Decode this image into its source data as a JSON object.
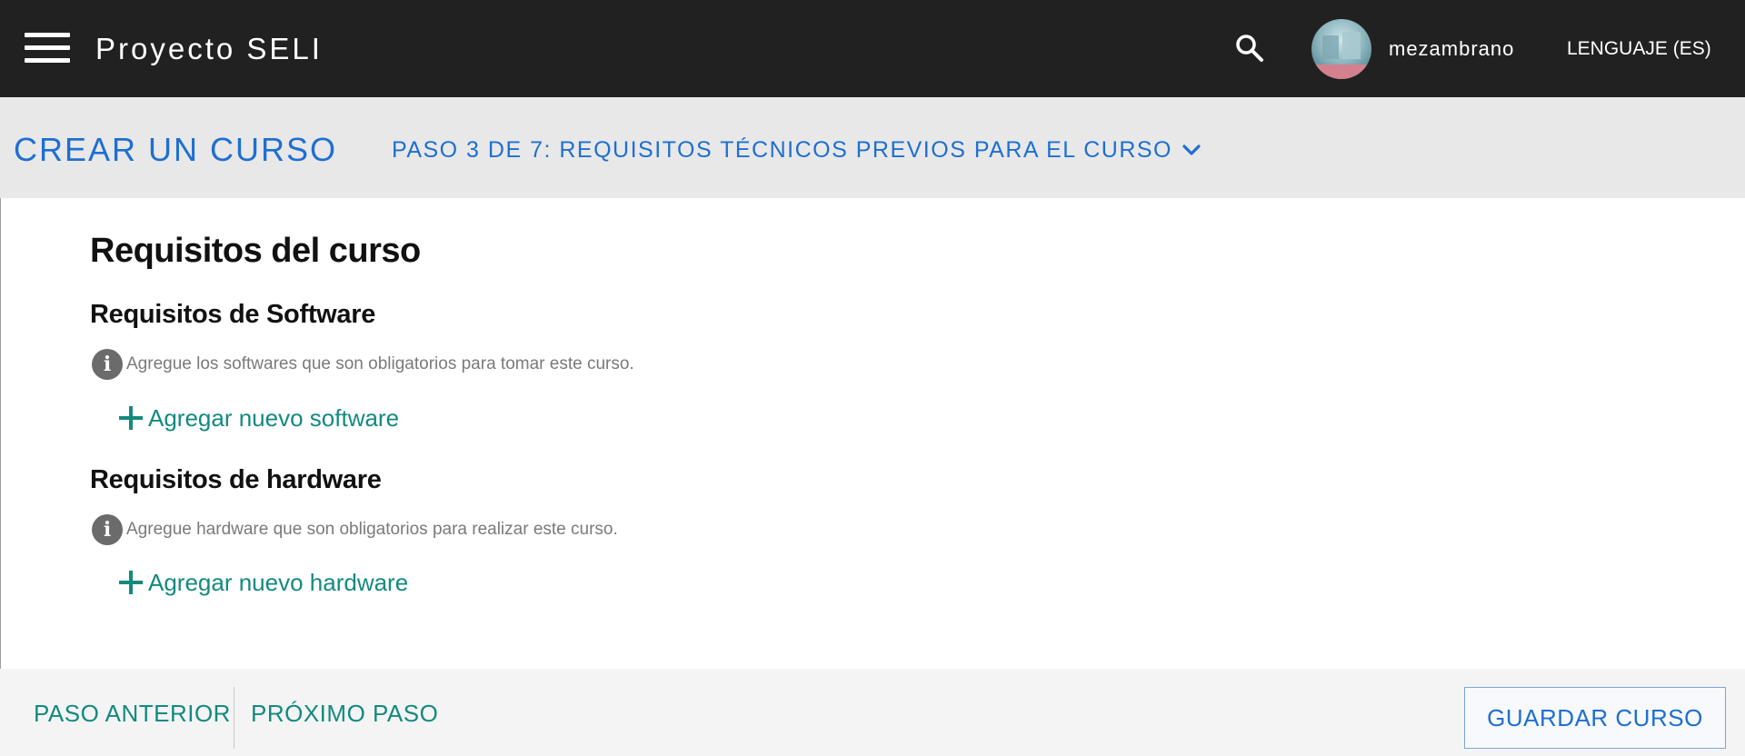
{
  "appbar": {
    "title": "Proyecto SELI",
    "username": "mezambrano",
    "language_label": "LENGUAJE (ES)",
    "icons": [
      "menu-icon",
      "search-icon",
      "avatar"
    ]
  },
  "stepbar": {
    "title": "CREAR UN CURSO",
    "current_step": "PASO 3 DE 7: REQUISITOS TÉCNICOS PREVIOS PARA EL CURSO"
  },
  "content": {
    "heading": "Requisitos del curso",
    "software": {
      "heading": "Requisitos de Software",
      "info": "Agregue los softwares que son obligatorios para tomar este curso.",
      "add_label": "Agregar nuevo software"
    },
    "hardware": {
      "heading": "Requisitos de hardware",
      "info": "Agregue hardware que son obligatorios para realizar este curso.",
      "add_label": "Agregar nuevo hardware"
    }
  },
  "footer": {
    "prev_label": "PASO ANTERIOR",
    "next_label": "PRÓXIMO PASO",
    "save_label": "GUARDAR CURSO"
  },
  "colors": {
    "appbar_bg": "#212121",
    "accent_blue": "#1e6fd1",
    "accent_teal": "#138a80",
    "stepbar_bg": "#e8e8e8",
    "footer_bg": "#f4f4f4"
  }
}
